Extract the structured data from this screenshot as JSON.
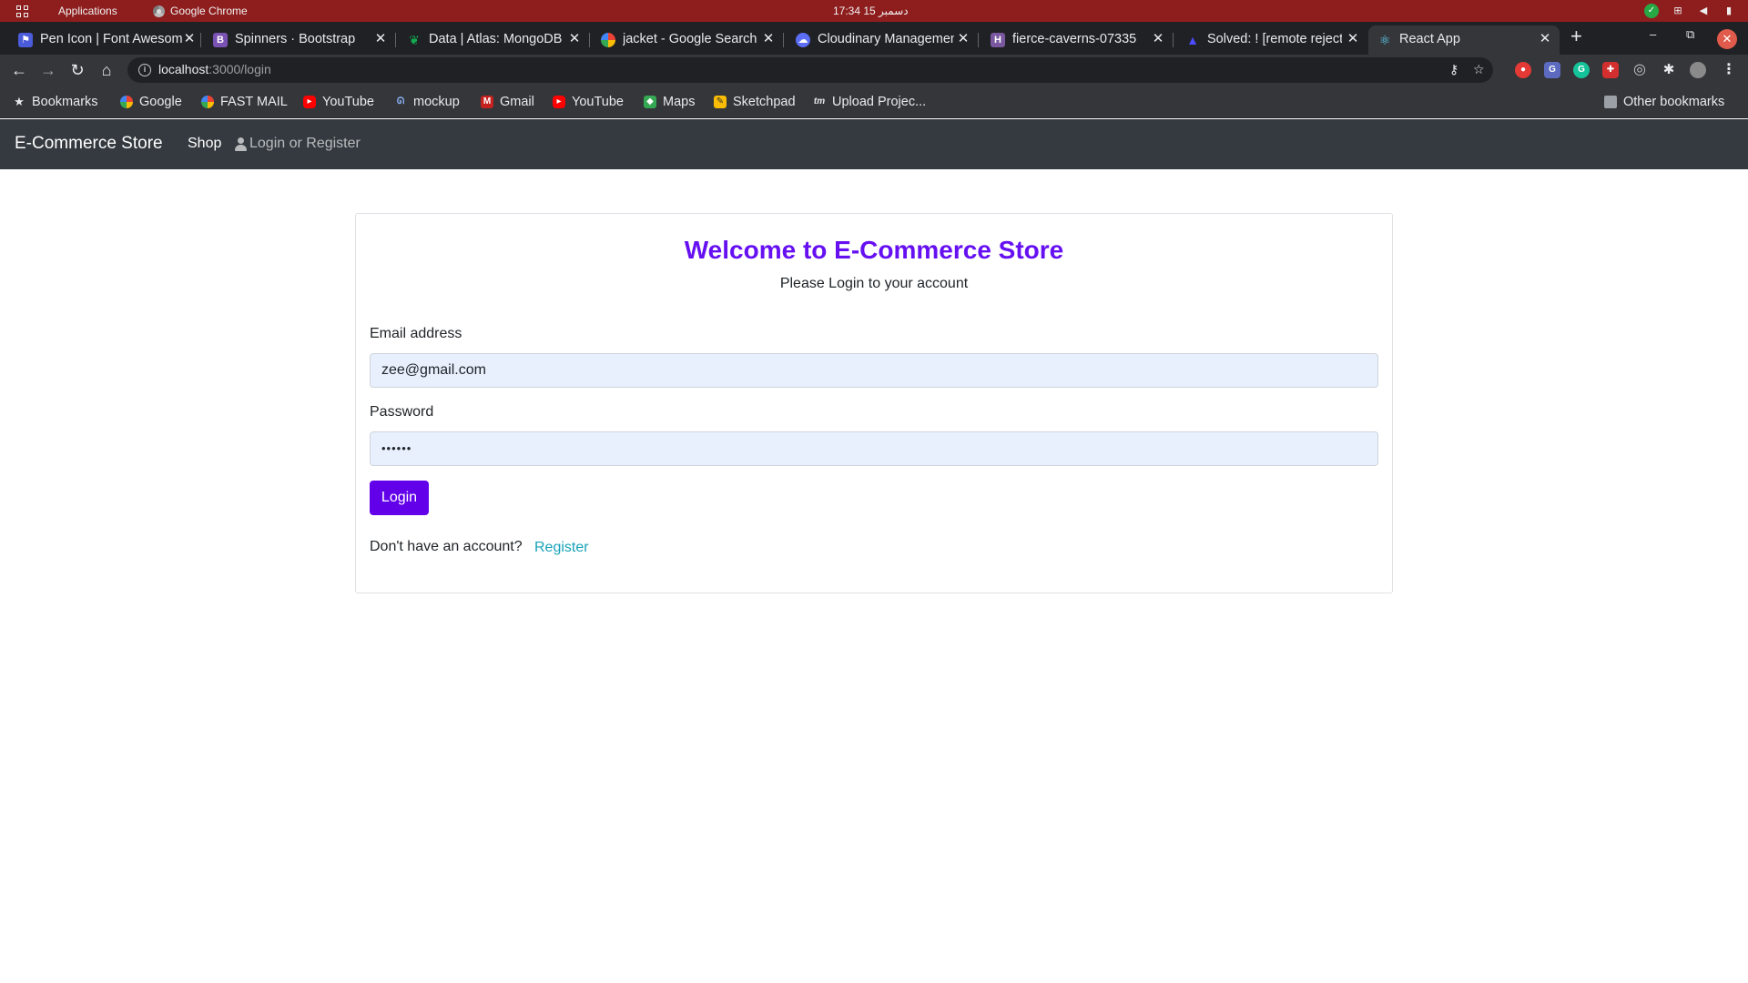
{
  "os": {
    "apps_label": "Applications",
    "browser_label": "Google Chrome",
    "clock": "17:34  15 دسمبر"
  },
  "tabs": [
    {
      "label": "Pen Icon | Font Awesome",
      "icon": "font-awesome-flag-icon",
      "color": "#4a5cd9"
    },
    {
      "label": "Spinners · Bootstrap",
      "icon": "bootstrap-icon",
      "color": "#7952b3"
    },
    {
      "label": "Data | Atlas: MongoDB",
      "icon": "mongodb-leaf-icon",
      "color": "#13aa52"
    },
    {
      "label": "jacket - Google Search",
      "icon": "google-icon",
      "color": "#4285f4"
    },
    {
      "label": "Cloudinary Management",
      "icon": "cloudinary-icon",
      "color": "#5b6ef5"
    },
    {
      "label": "fierce-caverns-07335",
      "icon": "heroku-icon",
      "color": "#79589f"
    },
    {
      "label": "Solved: ! [remote rejected]",
      "icon": "atlassian-icon",
      "color": "#4c4cff"
    },
    {
      "label": "React App",
      "icon": "react-icon",
      "color": "#61dafb"
    }
  ],
  "address": {
    "host": "localhost",
    "rest": ":3000/login"
  },
  "bookmarks": {
    "items": [
      {
        "label": "Bookmarks",
        "icon": "star-icon"
      },
      {
        "label": "Google",
        "icon": "google-icon"
      },
      {
        "label": "FAST MAIL",
        "icon": "google-icon"
      },
      {
        "label": "YouTube",
        "icon": "youtube-icon"
      },
      {
        "label": "mockup",
        "icon": "mockup-icon"
      },
      {
        "label": "Gmail",
        "icon": "gmail-icon"
      },
      {
        "label": "YouTube",
        "icon": "youtube-icon"
      },
      {
        "label": "Maps",
        "icon": "maps-icon"
      },
      {
        "label": "Sketchpad",
        "icon": "sketchpad-icon"
      },
      {
        "label": "Upload Projec...",
        "icon": "tm-icon"
      }
    ],
    "other": "Other bookmarks"
  },
  "navbar": {
    "brand": "E-Commerce Store",
    "shop": "Shop",
    "login_register": "Login or Register"
  },
  "login": {
    "title": "Welcome to E-Commerce Store",
    "subtitle": "Please Login to your account",
    "email_label": "Email address",
    "email_value": "zee@gmail.com",
    "password_label": "Password",
    "password_mask": "••••••",
    "button": "Login",
    "no_account": "Don't have an account?",
    "register": "Register"
  },
  "colors": {
    "os_bar": "#8e1e1e",
    "accent_purple": "#6200ea",
    "title_purple": "#6610f2",
    "link_teal": "#17a2b8",
    "navbar_dark": "#343a40",
    "input_fill": "#e8f0fe"
  }
}
